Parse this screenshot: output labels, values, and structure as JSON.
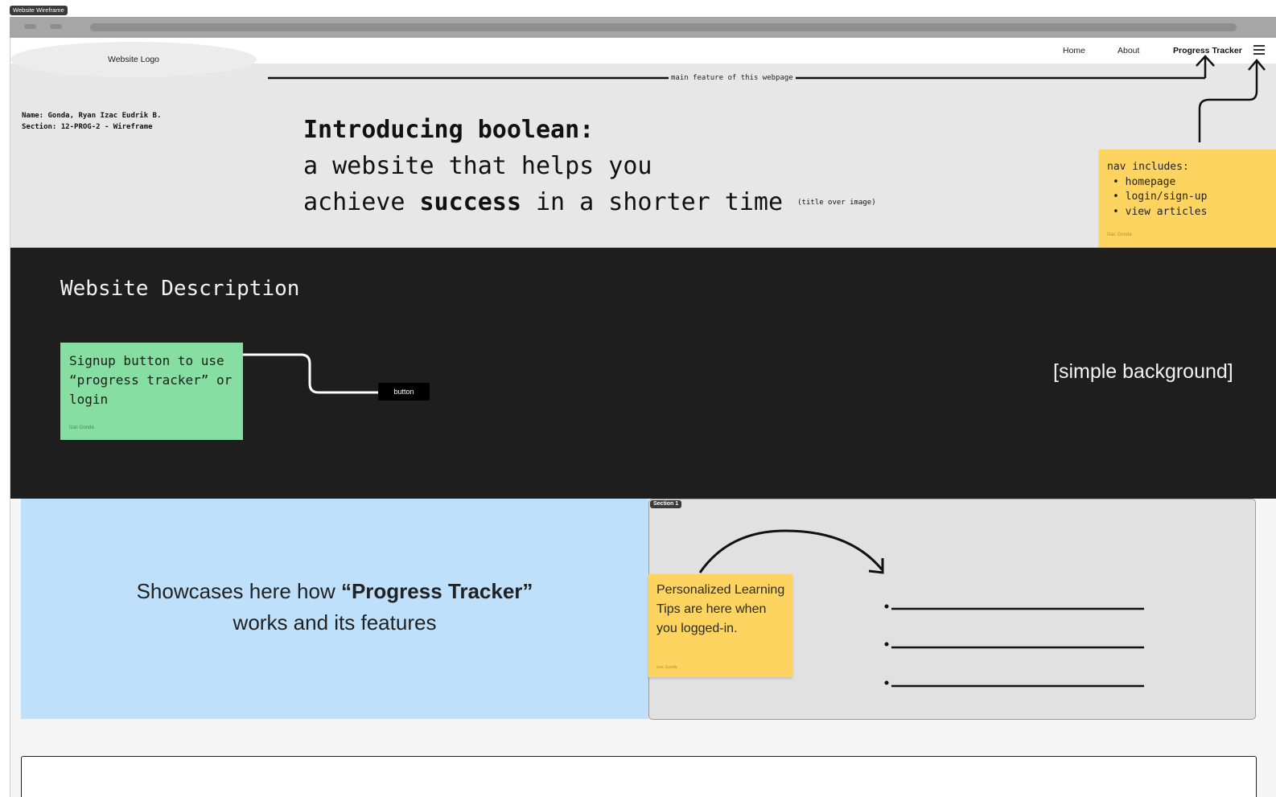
{
  "frame": {
    "label": "Website Wireframe"
  },
  "header": {
    "logo_text": "Website Logo",
    "nav": [
      "Home",
      "About",
      "Progress Tracker"
    ]
  },
  "hero": {
    "student_name": "Name: Gonda, Ryan Izac Eudrik B.",
    "student_section": "Section: 12-PROG-2  - Wireframe",
    "feature_label": "main feature of this webpage",
    "line1": "Introducing boolean:",
    "line2": "a website that helps you",
    "line3_prefix": "achieve ",
    "line3_bold": "success",
    "line3_suffix": " in a shorter time",
    "title_note": "(title over image)"
  },
  "sticky_nav": {
    "title": "nav includes:",
    "items": [
      "• homepage",
      "• login/sign-up",
      "• view articles"
    ],
    "author": "Izac Gonda"
  },
  "description": {
    "title": "Website Description",
    "sticky_text": "Signup button to use “progress tracker” or login",
    "sticky_author": "Izac Gonda",
    "button_label": "button",
    "background_note": "[simple background]"
  },
  "showcase": {
    "text_prefix": "Showcases here how ",
    "text_bold": "“Progress Tracker”",
    "text_suffix": "works and its features"
  },
  "section1": {
    "tag": "Section 1",
    "sticky_text": "Personalized Learning Tips are here when you logged-in.",
    "sticky_author": "Izac Gonda"
  }
}
